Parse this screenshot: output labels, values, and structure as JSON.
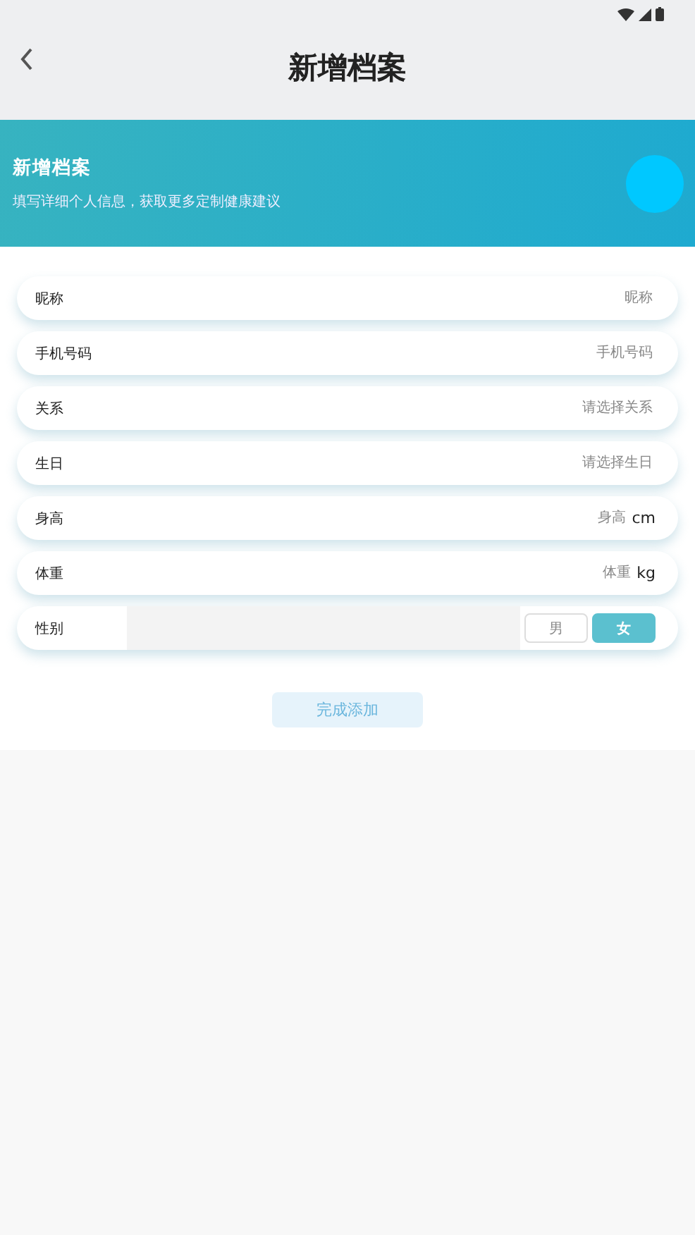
{
  "header": {
    "title": "新增档案"
  },
  "banner": {
    "title": "新增档案",
    "subtitle": "填写详细个人信息，获取更多定制健康建议"
  },
  "fields": [
    {
      "kind": "input",
      "label": "昵称",
      "placeholder": "昵称"
    },
    {
      "kind": "input",
      "label": "手机号码",
      "placeholder": "手机号码"
    },
    {
      "kind": "select",
      "label": "关系",
      "placeholder": "请选择关系"
    },
    {
      "kind": "select",
      "label": "生日",
      "placeholder": "请选择生日"
    },
    {
      "kind": "input",
      "label": "身高",
      "placeholder": "身高",
      "unit": "cm"
    },
    {
      "kind": "input",
      "label": "体重",
      "placeholder": "体重",
      "unit": "kg"
    },
    {
      "kind": "choice",
      "label": "性别",
      "options": [
        {
          "label": "男",
          "selected": false
        },
        {
          "label": "女",
          "selected": true
        }
      ]
    }
  ],
  "submit": "完成添加"
}
